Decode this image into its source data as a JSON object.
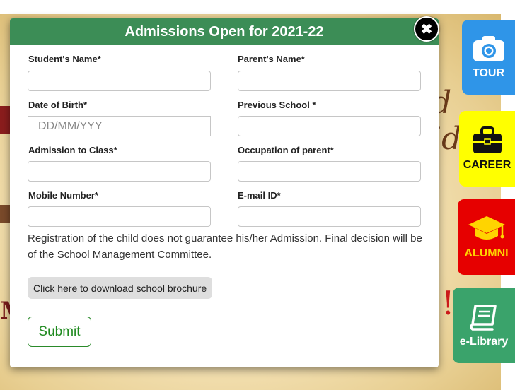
{
  "modal": {
    "title": "Admissions Open for 2021-22",
    "close_icon": "close-icon",
    "fields": {
      "student_name": {
        "label": "Student's Name*",
        "value": "",
        "placeholder": ""
      },
      "parent_name": {
        "label": "Parent's Name*",
        "value": "",
        "placeholder": ""
      },
      "dob": {
        "label": "Date of Birth*",
        "value": "",
        "placeholder": "DD/MM/YYY"
      },
      "previous_school": {
        "label": "Previous School *",
        "value": "",
        "placeholder": ""
      },
      "admission_class": {
        "label": "Admission to Class*",
        "value": "",
        "placeholder": ""
      },
      "parent_occupation": {
        "label": "Occupation of parent*",
        "value": "",
        "placeholder": ""
      },
      "mobile": {
        "label": "Mobile Number*",
        "value": "",
        "placeholder": ""
      },
      "email": {
        "label": "E-mail ID*",
        "value": "",
        "placeholder": ""
      }
    },
    "notice": "Registration of the child does not guarantee his/her Admission. Final decision will be of the School Management Committee.",
    "brochure_label": "Click here to download school brochure",
    "submit_label": "Submit"
  },
  "side_tabs": [
    {
      "label": "TOUR",
      "icon": "camera-icon",
      "bg": "#2f95e8",
      "color": "#ffffff"
    },
    {
      "label": "CAREER",
      "icon": "briefcase-icon",
      "bg": "#ffff00",
      "color": "#111111"
    },
    {
      "label": "ALUMNI",
      "icon": "graduation-cap-icon",
      "bg": "#e60000",
      "color": "#ffd400"
    },
    {
      "label": "e-Library",
      "icon": "book-icon",
      "bg": "#3aa36b",
      "color": "#ffffff"
    }
  ],
  "background": {
    "text_top": "d ide",
    "text_left": "M",
    "text_right": "!"
  },
  "colors": {
    "header": "#3c8d56",
    "submit": "#1f8a1f"
  }
}
